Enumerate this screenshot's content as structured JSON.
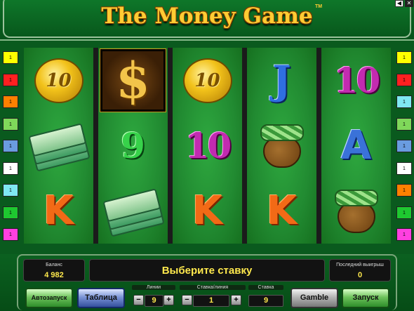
{
  "game": {
    "title": "The Money Game",
    "tm": "TM"
  },
  "window": {
    "sound_icon": "speaker-icon",
    "close_icon": "close-icon",
    "sound_glyph": "◀",
    "close_glyph": "✕"
  },
  "reels": [
    [
      "coin-10",
      "money-bills",
      "K"
    ],
    [
      "dollar",
      "9",
      "money-bills"
    ],
    [
      "coin-10",
      "10",
      "K"
    ],
    [
      "J",
      "money-bag",
      "K"
    ],
    [
      "10",
      "A",
      "money-bag"
    ]
  ],
  "reel_labels": {
    "coin": "10",
    "ten": "10",
    "nine": "9",
    "k": "K",
    "j": "J",
    "a": "A",
    "dollar": "$"
  },
  "lines_left": [
    {
      "n": "1",
      "color": "#ffff00"
    },
    {
      "n": "1",
      "color": "#ff2020"
    },
    {
      "n": "1",
      "color": "#ff8000"
    },
    {
      "n": "1",
      "color": "#7fd85a"
    },
    {
      "n": "1",
      "color": "#6a9ce0"
    },
    {
      "n": "1",
      "color": "#ffffff"
    },
    {
      "n": "1",
      "color": "#7fe8f2"
    },
    {
      "n": "1",
      "color": "#1ec830"
    },
    {
      "n": "1",
      "color": "#ff40e0"
    }
  ],
  "lines_right": [
    {
      "n": "1",
      "color": "#ffff00"
    },
    {
      "n": "1",
      "color": "#ff2020"
    },
    {
      "n": "1",
      "color": "#7fe8f2"
    },
    {
      "n": "1",
      "color": "#7fd85a"
    },
    {
      "n": "1",
      "color": "#6a9ce0"
    },
    {
      "n": "1",
      "color": "#ffffff"
    },
    {
      "n": "1",
      "color": "#ff8000"
    },
    {
      "n": "1",
      "color": "#1ec830"
    },
    {
      "n": "1",
      "color": "#ff40e0"
    }
  ],
  "status": {
    "balance_label": "Баланс",
    "balance": "4 982",
    "message": "Выберите ставку",
    "last_win_label": "Последний выигрыш",
    "last_win": "0"
  },
  "controls": {
    "autostart": "Автозапуск",
    "table": "Таблица",
    "lines_label": "Линии",
    "lines": "9",
    "bet_line_label": "Ставка/линия",
    "bet_line": "1",
    "bet_label": "Ставка",
    "bet": "9",
    "gamble": "Gamble",
    "start": "Запуск",
    "minus": "−",
    "plus": "+"
  }
}
